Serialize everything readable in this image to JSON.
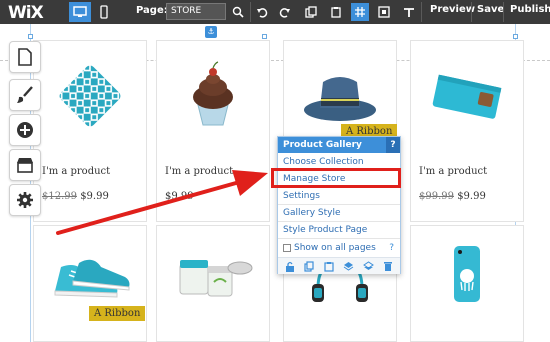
{
  "app": {
    "logo": "WiX",
    "page_label": "Page:",
    "page_value": "STORE",
    "toolbar_buttons": [
      "Preview",
      "Save",
      "Publish"
    ]
  },
  "left_panel": [
    "page-icon",
    "brush-icon",
    "add-icon",
    "store-icon",
    "gear-icon"
  ],
  "products": [
    {
      "name": "I'm a product",
      "price_old": "$12.99",
      "price": "$9.99",
      "image": "pillow-icon"
    },
    {
      "name": "I'm a product",
      "price_old": "",
      "price": "$9.99",
      "image": "cupcake-icon"
    },
    {
      "name": "I'm a product",
      "price_old": "",
      "price": "",
      "image": "hat-icon",
      "ribbon": "A Ribbon"
    },
    {
      "name": "I'm a product",
      "price_old": "$99.99",
      "price": "$9.99",
      "image": "wallet-icon"
    },
    {
      "name": "",
      "price_old": "",
      "price": "",
      "image": "sneakers-icon",
      "ribbon": "A Ribbon"
    },
    {
      "name": "",
      "price_old": "",
      "price": "",
      "image": "jars-icon"
    },
    {
      "name": "",
      "price_old": "",
      "price": "",
      "image": "headphones-icon"
    },
    {
      "name": "",
      "price_old": "",
      "price": "",
      "image": "phone-case-icon"
    }
  ],
  "popup": {
    "title": "Product Gallery",
    "help": "?",
    "items": [
      "Choose Collection",
      "Manage Store",
      "Settings",
      "Gallery Style",
      "Style Product Page"
    ],
    "checkbox_label": "Show on all pages",
    "checkbox_help": "?",
    "highlighted_item": "Manage Store"
  },
  "colors": {
    "accent": "#3d8fd9",
    "topbar": "#3a3a3a",
    "highlight": "#e0201b",
    "ribbon": "#d6b31c",
    "link": "#2f6eb3"
  }
}
